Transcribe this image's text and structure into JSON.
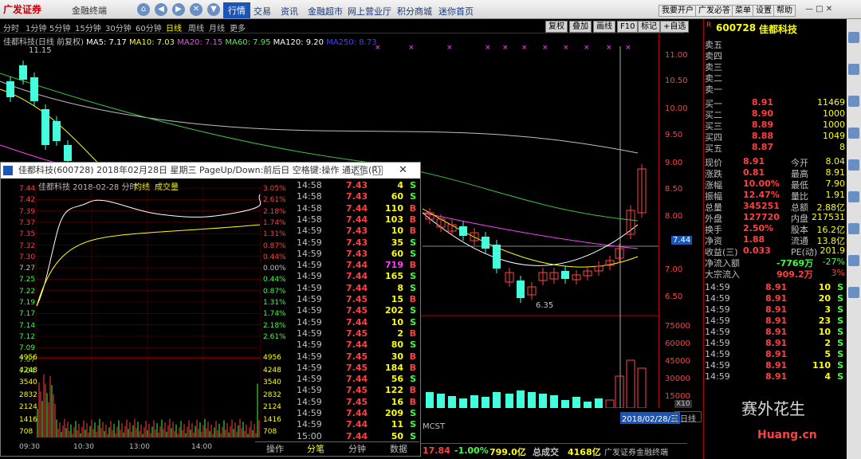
{
  "topbar": {
    "logo": "广发证券",
    "subtitle": "金融终端",
    "menus": [
      "行情",
      "交易",
      "资讯",
      "金融超市",
      "网上营业厅",
      "积分商城",
      "迷你首页"
    ],
    "right_buttons": [
      "我要开户",
      "广发必答",
      "菜单",
      "设置",
      "帮助"
    ]
  },
  "periods": [
    "分时",
    "1分钟",
    "5分钟",
    "15分钟",
    "30分钟",
    "60分钟",
    "日线",
    "周线",
    "月线",
    "更多"
  ],
  "toolbar": [
    "复权",
    "叠加",
    "画线",
    "F10",
    "标记",
    "+自选",
    "返回"
  ],
  "ma_line": {
    "name": "佳都科技(日线 前复权)",
    "ma5": "MA5: 7.17",
    "ma10": "MA10: 7.03",
    "ma20": "MA20: 7.15",
    "ma60": "MA60: 7.95",
    "ma120": "MA120: 9.20",
    "ma250": "MA250: 8.73"
  },
  "price_axis": [
    "11.00",
    "10.50",
    "10.00",
    "9.50",
    "9.00",
    "8.50",
    "8.00",
    "7.44",
    "7.00",
    "6.50"
  ],
  "vol_axis": [
    "75000",
    "60000",
    "45000",
    "30000",
    "15000",
    "X10"
  ],
  "annotations": {
    "high": "11.15",
    "low": "6.35",
    "last": "7.44"
  },
  "bottom_left": {
    "tag": "MCST",
    "date": "2018/02/28/三",
    "tab": "日线"
  },
  "quote": {
    "code": "600728",
    "name": "佳都科技",
    "sell": [
      {
        "l": "卖五",
        "p": "",
        "v": ""
      },
      {
        "l": "卖四",
        "p": "",
        "v": ""
      },
      {
        "l": "卖三",
        "p": "",
        "v": ""
      },
      {
        "l": "卖二",
        "p": "",
        "v": ""
      },
      {
        "l": "卖一",
        "p": "",
        "v": ""
      }
    ],
    "buy": [
      {
        "l": "买一",
        "p": "8.91",
        "v": "11469"
      },
      {
        "l": "买二",
        "p": "8.90",
        "v": "1000"
      },
      {
        "l": "买三",
        "p": "8.89",
        "v": "1000"
      },
      {
        "l": "买四",
        "p": "8.88",
        "v": "1049"
      },
      {
        "l": "买五",
        "p": "8.87",
        "v": "8"
      }
    ],
    "stats": [
      [
        "现价",
        "8.91",
        "今开",
        "8.04"
      ],
      [
        "涨跌",
        "0.81",
        "最高",
        "8.91"
      ],
      [
        "涨幅",
        "10.00%",
        "最低",
        "7.90"
      ],
      [
        "振幅",
        "12.47%",
        "量比",
        "1.91"
      ],
      [
        "总量",
        "345251",
        "总额",
        "2.88亿"
      ],
      [
        "外盘",
        "127720",
        "内盘",
        "217531"
      ],
      [
        "换手",
        "2.50%",
        "股本",
        "16.2亿"
      ],
      [
        "净资",
        "1.88",
        "流通",
        "13.8亿"
      ],
      [
        "收益(三)",
        "0.033",
        "PE(动)",
        "201.9"
      ]
    ],
    "flow1": [
      "净流入额",
      "-7769万",
      "-27%"
    ],
    "flow2": [
      "大宗流入",
      "909.2万",
      "3%"
    ],
    "deals": [
      [
        "14:59",
        "8.91",
        "10",
        "S"
      ],
      [
        "14:59",
        "8.91",
        "20",
        "S"
      ],
      [
        "14:59",
        "8.91",
        "3",
        "S"
      ],
      [
        "14:59",
        "8.91",
        "23",
        "S"
      ],
      [
        "14:59",
        "8.91",
        "10",
        "S"
      ],
      [
        "14:59",
        "8.91",
        "2",
        "S"
      ],
      [
        "14:59",
        "8.91",
        "5",
        "S"
      ],
      [
        "14:59",
        "8.91",
        "110",
        "S"
      ],
      [
        "14:59",
        "8.91",
        "4",
        "S"
      ]
    ]
  },
  "popup": {
    "title": "佳都科技(600728) 2018年02月28日 星期三 PageUp/Down:前后日 空格键:操作 通达信(R)",
    "header": "佳都科技  2018-02-28 分时",
    "legend1": "均线",
    "legend2": "成交量",
    "left_prices": [
      "7.44",
      "7.42",
      "7.39",
      "7.37",
      "7.35",
      "7.32",
      "7.30",
      "7.27",
      "7.25",
      "7.22",
      "7.19",
      "7.17",
      "7.14",
      "7.12",
      "7.09",
      "7.07",
      "7.04"
    ],
    "right_pcts": [
      "3.05%",
      "2.61%",
      "2.18%",
      "1.74%",
      "1.31%",
      "0.87%",
      "0.44%",
      "0.00%",
      "0.44%",
      "0.87%",
      "1.31%",
      "1.74%",
      "2.18%",
      "2.61%"
    ],
    "vol_labels": [
      "4956",
      "4248",
      "3540",
      "2832",
      "2124",
      "1416",
      "708"
    ],
    "time_labels": [
      "09:30",
      "10:30",
      "13:00",
      "14:00"
    ],
    "ticks": [
      [
        "14:58",
        "7.43",
        "4",
        "S"
      ],
      [
        "14:58",
        "7.43",
        "60",
        "S"
      ],
      [
        "14:58",
        "7.44",
        "110",
        "B"
      ],
      [
        "14:58",
        "7.44",
        "103",
        "B"
      ],
      [
        "14:59",
        "7.43",
        "10",
        "B"
      ],
      [
        "14:59",
        "7.43",
        "35",
        "S"
      ],
      [
        "14:59",
        "7.43",
        "60",
        "S"
      ],
      [
        "14:59",
        "7.44",
        "719",
        "B"
      ],
      [
        "14:59",
        "7.44",
        "165",
        "S"
      ],
      [
        "14:59",
        "7.44",
        "8",
        "S"
      ],
      [
        "14:59",
        "7.45",
        "15",
        "B"
      ],
      [
        "14:59",
        "7.45",
        "202",
        "S"
      ],
      [
        "14:59",
        "7.44",
        "10",
        "S"
      ],
      [
        "14:59",
        "7.45",
        "2",
        "B"
      ],
      [
        "14:59",
        "7.44",
        "80",
        "S"
      ],
      [
        "14:59",
        "7.45",
        "30",
        "B"
      ],
      [
        "14:59",
        "7.45",
        "184",
        "B"
      ],
      [
        "14:59",
        "7.44",
        "56",
        "S"
      ],
      [
        "14:59",
        "7.45",
        "122",
        "B"
      ],
      [
        "14:59",
        "7.45",
        "16",
        "B"
      ],
      [
        "14:59",
        "7.44",
        "209",
        "S"
      ],
      [
        "14:59",
        "7.44",
        "11",
        "S"
      ],
      [
        "15:00",
        "7.44",
        "50",
        "S"
      ]
    ],
    "tabs": [
      "操作",
      "分笔",
      "分钟",
      "数据"
    ]
  },
  "bottombar": {
    "v1": "17.84",
    "v2": "-1.00%",
    "v3": "799.0亿",
    "v4": "总成交",
    "v5": "4168亿",
    "v6": "广发证券金融终端"
  },
  "watermark": {
    "text": "赛外花生",
    "url": "Huang.cn"
  },
  "chart_data": {
    "type": "candlestick",
    "series": [
      {
        "name": "daily",
        "last_close": 8.91,
        "prev_close": 8.1,
        "high": 8.91,
        "low": 7.9
      }
    ]
  }
}
